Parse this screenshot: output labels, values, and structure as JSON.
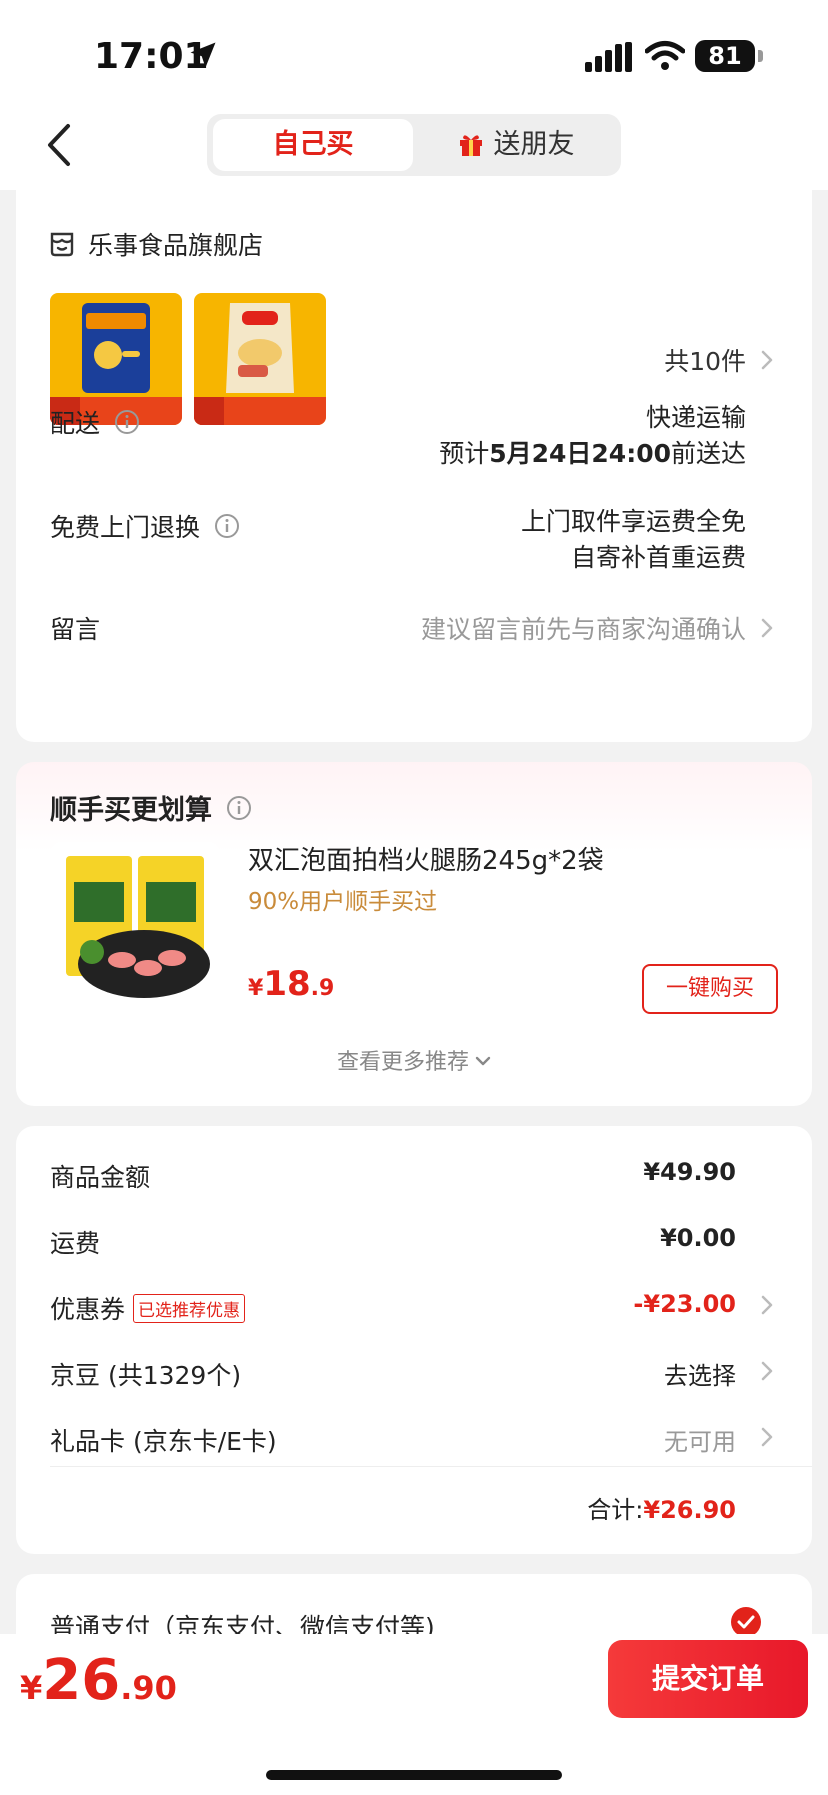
{
  "status": {
    "time": "17:01",
    "battery": "81"
  },
  "header": {
    "tab_self": "自己买",
    "tab_gift": "送朋友"
  },
  "store": {
    "name": "乐事食品旗舰店",
    "count_label": "共10件"
  },
  "delivery": {
    "label": "配送",
    "method": "快递运输",
    "estimate_prefix": "预计",
    "estimate_date": "5月24日24:00",
    "estimate_suffix": "前送达"
  },
  "returns": {
    "label": "免费上门退换",
    "line1": "上门取件享运费全免",
    "line2": "自寄补首重运费"
  },
  "message": {
    "label": "留言",
    "placeholder": "建议留言前先与商家沟通确认"
  },
  "recommend": {
    "title": "顺手买更划算",
    "product_name": "双汇泡面拍档火腿肠245g*2袋",
    "sub": "90%用户顺手买过",
    "price_currency": "¥",
    "price_int": "18",
    "price_dec": ".9",
    "buy_label": "一键购买",
    "more_label": "查看更多推荐"
  },
  "summary": {
    "goods_label": "商品金额",
    "goods_value": "¥49.90",
    "shipping_label": "运费",
    "shipping_value": "¥0.00",
    "coupon_label": "优惠券",
    "coupon_tag": "已选推荐优惠",
    "coupon_value": "-¥23.00",
    "beans_label": "京豆 (共1329个)",
    "beans_value": "去选择",
    "giftcard_label": "礼品卡 (京东卡/E卡)",
    "giftcard_value": "无可用",
    "total_label": "合计:",
    "total_value": "¥26.90"
  },
  "payment": {
    "label": "普通支付（京东支付、微信支付等)"
  },
  "bottom": {
    "price_currency": "¥",
    "price_int": "26",
    "price_dec": ".90",
    "submit_label": "提交订单"
  },
  "colors": {
    "accent": "#e2231a",
    "background": "#f2f2f2"
  },
  "icons": [
    "location-arrow-icon",
    "signal-icon",
    "wifi-icon",
    "battery-icon",
    "back-chevron-icon",
    "gift-icon",
    "store-icon",
    "info-icon",
    "chevron-right-icon",
    "chevron-down-icon",
    "check-circle-icon"
  ]
}
